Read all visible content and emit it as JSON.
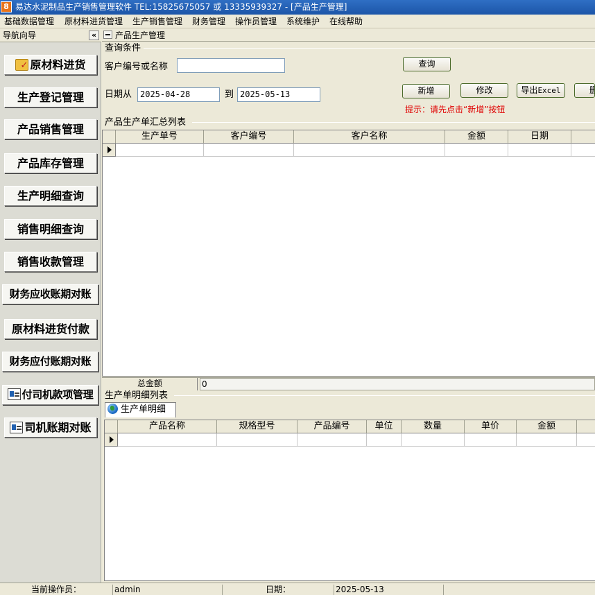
{
  "window": {
    "icon_letter": "8",
    "title": "易达水泥制品生产销售管理软件  TEL:15825675057 或 13335939327  - [产品生产管理]"
  },
  "menu": [
    "基础数据管理",
    "原材料进货管理",
    "生产销售管理",
    "财务管理",
    "操作员管理",
    "系统维护",
    "在线帮助"
  ],
  "nav": {
    "title": "导航向导",
    "collapse_label": "«",
    "items": [
      {
        "label": "原材料进货",
        "icon": "folder-check-icon"
      },
      {
        "label": "生产登记管理"
      },
      {
        "label": "产品销售管理"
      },
      {
        "label": "产品库存管理"
      },
      {
        "label": "生产明细查询"
      },
      {
        "label": "销售明细查询"
      },
      {
        "label": "销售收款管理"
      },
      {
        "label": "财务应收账期对账"
      },
      {
        "label": "原材料进货付款"
      },
      {
        "label": "财务应付账期对账"
      },
      {
        "label": "付司机款项管理",
        "icon": "id-card-icon"
      },
      {
        "label": "司机账期对账",
        "icon": "id-card-icon"
      }
    ]
  },
  "main": {
    "title": "产品生产管理",
    "query": {
      "group_label": "查询条件",
      "customer_label": "客户编号或名称",
      "customer_value": "",
      "date_from_label": "日期从",
      "date_from": "2025-04-28",
      "date_to_label": "到",
      "date_to": "2025-05-13"
    },
    "buttons": {
      "query": "查询",
      "add": "新增",
      "edit": "修改",
      "export_prefix": "导出",
      "export_suffix": "Excel",
      "delete": "删"
    },
    "hint": "提示：请先点击“新增”按钮",
    "summary": {
      "label": "产品生产单汇总列表",
      "columns": [
        "生产单号",
        "客户编号",
        "客户名称",
        "金额",
        "日期"
      ],
      "total_label": "总金额",
      "total_value": "0"
    },
    "detail": {
      "label": "生产单明细列表",
      "tab": "生产单明细",
      "columns": [
        "产品名称",
        "规格型号",
        "产品编号",
        "单位",
        "数量",
        "单价",
        "金额"
      ]
    }
  },
  "status": {
    "operator_label": "当前操作员：",
    "operator": "admin",
    "date_label": "日期：",
    "date": "2025-05-13"
  }
}
